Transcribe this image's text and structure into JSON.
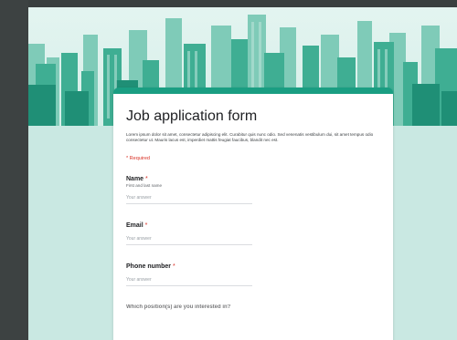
{
  "form": {
    "title": "Job application form",
    "description": "Lorem ipsum dolor sit amet, consectetur adipiscing elit. Curabitur quis nunc odio. Sed venenatis vestibulum dui, sit amet tempus odio consectetur ut. Mauris lacus est, imperdiet mattis feugiat faucibus, blandit nec est.",
    "required_note": "* Required",
    "questions": [
      {
        "label": "Name",
        "required_mark": "*",
        "sublabel": "First and last name",
        "placeholder": "Your answer"
      },
      {
        "label": "Email",
        "required_mark": "*",
        "sublabel": "",
        "placeholder": "Your answer"
      },
      {
        "label": "Phone number",
        "required_mark": "*",
        "sublabel": "",
        "placeholder": "Your answer"
      }
    ],
    "next_question_partial": "Which position(s) are you interested in?"
  },
  "colors": {
    "accent": "#1a9e82",
    "page_background": "#c9e8e2",
    "required": "#d93025"
  }
}
